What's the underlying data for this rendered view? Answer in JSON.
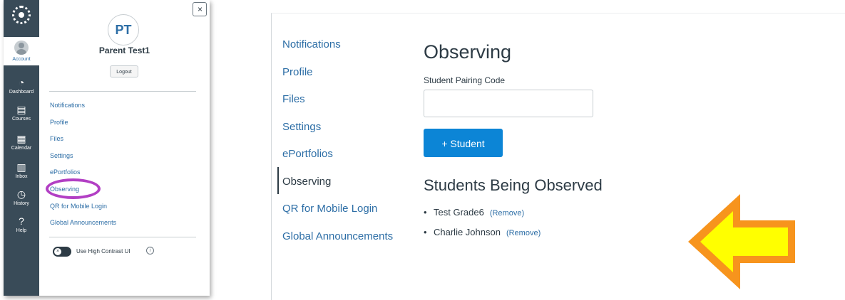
{
  "global_nav": {
    "items": [
      {
        "key": "account",
        "label": "Account",
        "icon": "avatar-icon"
      },
      {
        "key": "dashboard",
        "label": "Dashboard",
        "icon": "speedometer-icon"
      },
      {
        "key": "courses",
        "label": "Courses",
        "icon": "book-icon"
      },
      {
        "key": "calendar",
        "label": "Calendar",
        "icon": "calendar-icon"
      },
      {
        "key": "inbox",
        "label": "Inbox",
        "icon": "inbox-icon"
      },
      {
        "key": "history",
        "label": "History",
        "icon": "clock-icon"
      },
      {
        "key": "help",
        "label": "Help",
        "icon": "question-icon"
      }
    ]
  },
  "tray": {
    "close_label": "×",
    "avatar_initials": "PT",
    "user_name": "Parent Test1",
    "logout_label": "Logout",
    "links": [
      "Notifications",
      "Profile",
      "Files",
      "Settings",
      "ePortfolios",
      "Observing",
      "QR for Mobile Login",
      "Global Announcements"
    ],
    "high_contrast_label": "Use High Contrast UI",
    "high_contrast_on": false,
    "info_glyph": "i"
  },
  "settings_nav": {
    "items": [
      {
        "label": "Notifications",
        "current": false
      },
      {
        "label": "Profile",
        "current": false
      },
      {
        "label": "Files",
        "current": false
      },
      {
        "label": "Settings",
        "current": false
      },
      {
        "label": "ePortfolios",
        "current": false
      },
      {
        "label": "Observing",
        "current": true
      },
      {
        "label": "QR for Mobile Login",
        "current": false
      },
      {
        "label": "Global Announcements",
        "current": false
      }
    ]
  },
  "main": {
    "title": "Observing",
    "pairing_label": "Student Pairing Code",
    "pairing_value": "",
    "add_button_label": "+ Student",
    "observed_heading": "Students Being Observed",
    "students": [
      {
        "name": "Test Grade6",
        "remove_label": "(Remove)"
      },
      {
        "name": "Charlie Johnson",
        "remove_label": "(Remove)"
      }
    ]
  },
  "colors": {
    "nav_bg": "#394b58",
    "link": "#2d6ea6",
    "button": "#0c85d6",
    "highlight_circle": "#b23fc4",
    "arrow_fill": "#ffff00",
    "arrow_outline": "#f7941d"
  }
}
